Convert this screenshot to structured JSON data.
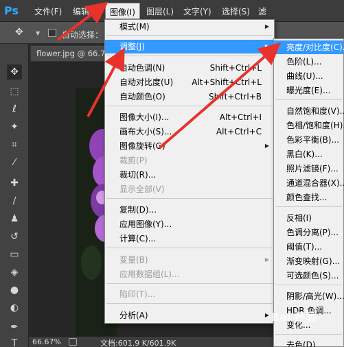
{
  "menubar": {
    "logo": "Ps",
    "items": [
      "文件(F)",
      "编辑(E)",
      "图像(I)",
      "图层(L)",
      "文字(Y)",
      "选择(S)",
      "滤"
    ]
  },
  "options": {
    "autoselect_label": "自动选择："
  },
  "document": {
    "tab_title": "flower.jpg @ 66.7%"
  },
  "status": {
    "zoom": "66.67%",
    "doc_size": "文档:601.9 K/601.9K"
  },
  "image_menu": {
    "items": [
      {
        "label": "模式(M)",
        "shortcut": "",
        "submenu": true
      },
      {
        "label": "调整(J)",
        "shortcut": "",
        "submenu": true,
        "highlighted": true
      },
      {
        "label": "自动色调(N)",
        "shortcut": "Shift+Ctrl+L"
      },
      {
        "label": "自动对比度(U)",
        "shortcut": "Alt+Shift+Ctrl+L"
      },
      {
        "label": "自动颜色(O)",
        "shortcut": "Shift+Ctrl+B"
      },
      {
        "label": "图像大小(I)...",
        "shortcut": "Alt+Ctrl+I"
      },
      {
        "label": "画布大小(S)...",
        "shortcut": "Alt+Ctrl+C"
      },
      {
        "label": "图像旋转(G)",
        "shortcut": "",
        "submenu": true
      },
      {
        "label": "裁剪(P)",
        "shortcut": "",
        "disabled": true
      },
      {
        "label": "裁切(R)...",
        "shortcut": ""
      },
      {
        "label": "显示全部(V)",
        "shortcut": "",
        "disabled": true
      },
      {
        "label": "复制(D)...",
        "shortcut": ""
      },
      {
        "label": "应用图像(Y)...",
        "shortcut": ""
      },
      {
        "label": "计算(C)...",
        "shortcut": ""
      },
      {
        "label": "变量(B)",
        "shortcut": "",
        "disabled": true,
        "submenu": true
      },
      {
        "label": "应用数据组(L)...",
        "shortcut": "",
        "disabled": true
      },
      {
        "label": "陷印(T)...",
        "shortcut": "",
        "disabled": true
      },
      {
        "label": "分析(A)",
        "shortcut": "",
        "submenu": true
      }
    ]
  },
  "adjust_menu": {
    "items": [
      {
        "label": "亮度/对比度(C)...",
        "highlighted": true
      },
      {
        "label": "色阶(L)..."
      },
      {
        "label": "曲线(U)..."
      },
      {
        "label": "曝光度(E)..."
      },
      {
        "label": "自然饱和度(V)..."
      },
      {
        "label": "色相/饱和度(H)..."
      },
      {
        "label": "色彩平衡(B)..."
      },
      {
        "label": "黑白(K)..."
      },
      {
        "label": "照片滤镜(F)..."
      },
      {
        "label": "通道混合器(X)..."
      },
      {
        "label": "颜色查找..."
      },
      {
        "label": "反相(I)"
      },
      {
        "label": "色调分离(P)..."
      },
      {
        "label": "阈值(T)..."
      },
      {
        "label": "渐变映射(G)..."
      },
      {
        "label": "可选颜色(S)..."
      },
      {
        "label": "阴影/高光(W)..."
      },
      {
        "label": "HDR 色调..."
      },
      {
        "label": "变化..."
      },
      {
        "label": "去色(D)"
      }
    ]
  },
  "watermark": "Bai 经验",
  "colors": {
    "highlight": "#3399ff",
    "arrow": "#e8322b",
    "ps_blue": "#31a8ff"
  }
}
